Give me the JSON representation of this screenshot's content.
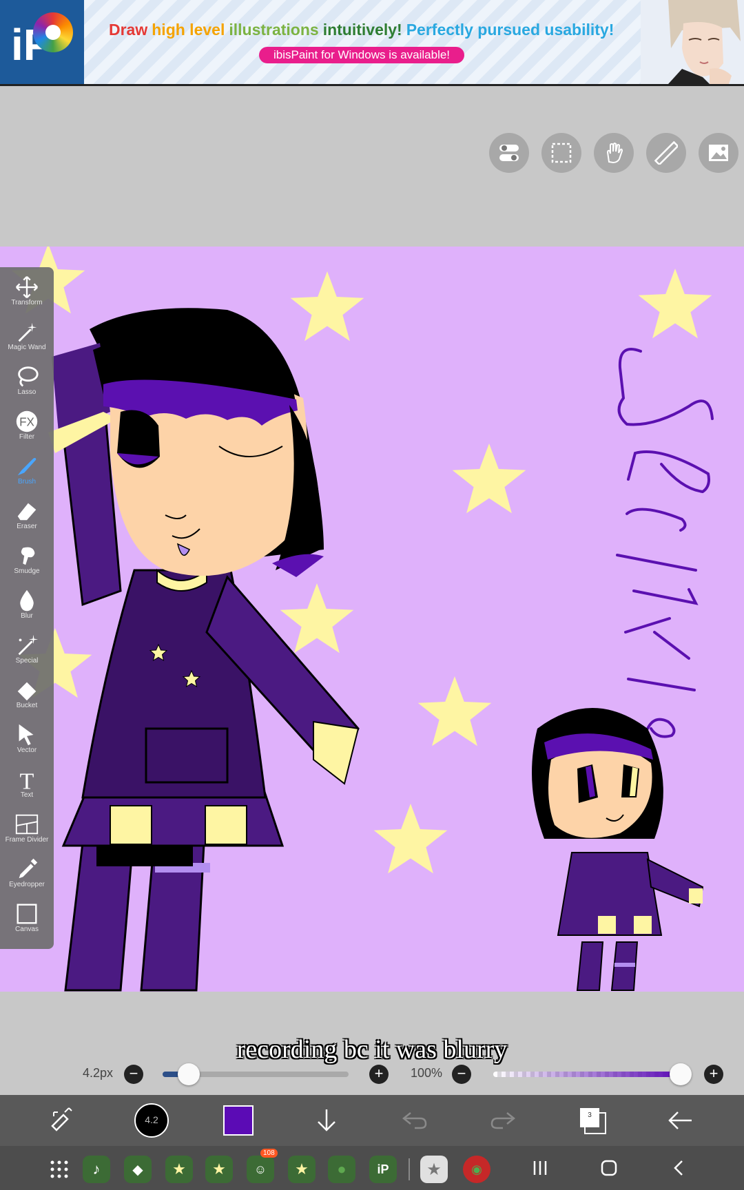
{
  "ad": {
    "headline": [
      {
        "text": "Draw",
        "color": "#e53935"
      },
      {
        "text": "high level",
        "color": "#f5a300"
      },
      {
        "text": "illustrations",
        "color": "#7cb342"
      },
      {
        "text": "intuitively!",
        "color": "#2e7d32"
      },
      {
        "text": "Perfectly pursued usability!",
        "color": "#29a8e0"
      }
    ],
    "badge": "ibisPaint for Windows is available!",
    "logo_text": "iP"
  },
  "top_buttons": [
    "toggle-icon",
    "selection-icon",
    "hand-icon",
    "ruler-icon",
    "gallery-icon"
  ],
  "canvas": {
    "background": "#dfb1fb",
    "lettering": "Sparkle",
    "accent_purple": "#4b1a82",
    "star_color": "#fef5a3"
  },
  "tools": [
    {
      "name": "Transform",
      "icon": "move-icon",
      "active": false
    },
    {
      "name": "Magic Wand",
      "icon": "magic-wand-icon",
      "active": false
    },
    {
      "name": "Lasso",
      "icon": "lasso-icon",
      "active": false
    },
    {
      "name": "Filter",
      "icon": "fx-icon",
      "active": false
    },
    {
      "name": "Brush",
      "icon": "brush-icon",
      "active": true
    },
    {
      "name": "Eraser",
      "icon": "eraser-icon",
      "active": false
    },
    {
      "name": "Smudge",
      "icon": "smudge-icon",
      "active": false
    },
    {
      "name": "Blur",
      "icon": "blur-drop-icon",
      "active": false
    },
    {
      "name": "Special",
      "icon": "special-icon",
      "active": false
    },
    {
      "name": "Bucket",
      "icon": "bucket-icon",
      "active": false
    },
    {
      "name": "Vector",
      "icon": "vector-arrow-icon",
      "active": false
    },
    {
      "name": "Text",
      "icon": "text-icon",
      "active": false
    },
    {
      "name": "Frame Divider",
      "icon": "frame-divider-icon",
      "active": false
    },
    {
      "name": "Eyedropper",
      "icon": "eyedropper-icon",
      "active": false
    },
    {
      "name": "Canvas",
      "icon": "canvas-icon",
      "active": false
    }
  ],
  "caption": "recording bc it was blurry",
  "brush": {
    "size_label": "4.2px",
    "size_fraction": 0.14,
    "color": "#5b0bb5"
  },
  "opacity": {
    "label": "100%",
    "fraction": 1.0
  },
  "bottom_bar": {
    "brush_size_badge": "4.2",
    "layer_count": "3",
    "current_color": "#5b0bb5"
  },
  "navbar": {
    "notification_badge": "108"
  }
}
